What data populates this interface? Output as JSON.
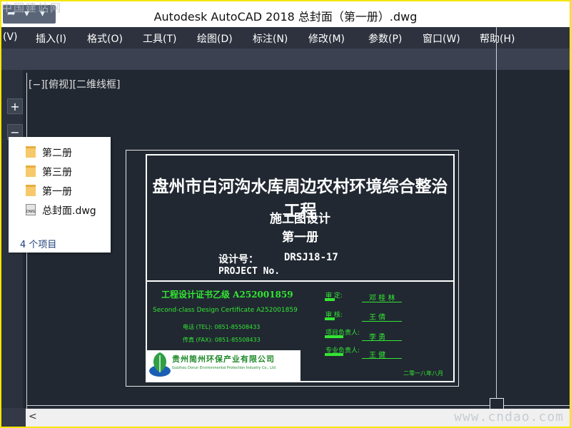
{
  "window": {
    "title": "Autodesk AutoCAD 2018     总封面（第一册）.dwg",
    "watermark_top": "中国建站网",
    "watermark_bottom": "www.cndao.com"
  },
  "menu": {
    "items": [
      "(V)",
      "插入(I)",
      "格式(O)",
      "工具(T)",
      "绘图(D)",
      "标注(N)",
      "修改(M)",
      "参数(P)",
      "窗口(W)",
      "帮助(H)"
    ]
  },
  "viewport": {
    "label": "[−][俯视][二维线框]",
    "zoom_in": "+",
    "zoom_out": "−"
  },
  "drawing": {
    "project_title": "盘州市白河沟水库周边农村环境综合整治工程",
    "subtitle1": "施工图设计",
    "subtitle2": "第一册",
    "design_no_label": "设计号：",
    "design_no_value": "DRSJ18-17",
    "project_no_label": "PROJECT  No.",
    "cert_cn": "工程设计证书乙级 A252001859",
    "cert_en": "Second-class Design Certificate A252001859",
    "tel": "电话 (TEL):  0851-85508433",
    "fax": "传真 (FAX):  0851-85508433",
    "date": "二零一八年八月",
    "signatures": [
      {
        "role": "审    定:",
        "name": "邓 桂 林"
      },
      {
        "role": "审    核:",
        "name": "王    倩"
      },
      {
        "role": "项目负责人:",
        "name": "李    勇"
      },
      {
        "role": "专业负责人:",
        "name": "王    健"
      }
    ],
    "company_cn": "贵州简州环保产业有限公司",
    "company_en": "Guizhou Dorun Environmental Protection Industry Co., Ltd",
    "line_color": "#ffffff",
    "green": "#33e633"
  },
  "popup": {
    "items": [
      {
        "icon": "folder-icon",
        "label": "第二册"
      },
      {
        "icon": "folder-icon",
        "label": "第三册"
      },
      {
        "icon": "folder-icon",
        "label": "第一册"
      },
      {
        "icon": "dwg-file-icon",
        "label": "总封面.dwg"
      }
    ],
    "count": "4 个项目"
  }
}
